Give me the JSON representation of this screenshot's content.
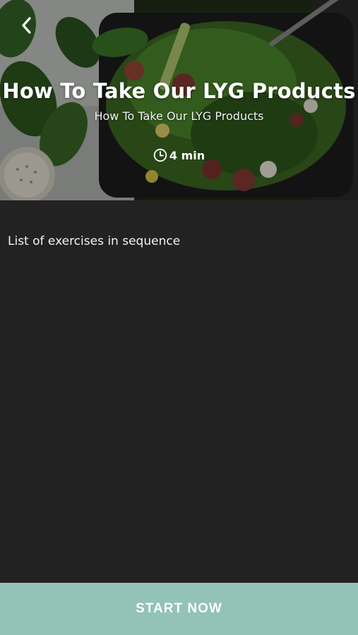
{
  "header": {
    "back_icon": "chevron-left-icon",
    "title": "How To Take Our LYG Products",
    "subtitle": "How To Take Our LYG Products",
    "duration_icon": "clock-icon",
    "duration": "4 min"
  },
  "content": {
    "section_label": "List of exercises in sequence"
  },
  "footer": {
    "start_label": "START NOW"
  },
  "colors": {
    "background": "#222222",
    "accent_button": "#93c2b6",
    "text": "#ffffff"
  }
}
